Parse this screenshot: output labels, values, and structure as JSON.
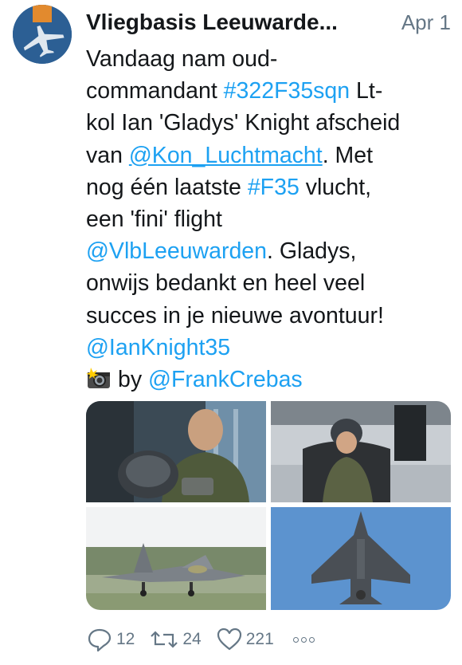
{
  "tweet": {
    "author_name": "Vliegbasis Leeuwarde...",
    "date": "Apr 1",
    "text_lines": [
      [
        {
          "t": "Vandaag nam oud-"
        }
      ],
      [
        {
          "t": "commandant "
        },
        {
          "t": "#322F35sqn",
          "link": true
        },
        {
          "t": " Lt-"
        }
      ],
      [
        {
          "t": "kol Ian 'Gladys' Knight afscheid"
        }
      ],
      [
        {
          "t": "van "
        },
        {
          "t": "@Kon_Luchtmacht",
          "link": true,
          "underline": true
        },
        {
          "t": ". Met"
        }
      ],
      [
        {
          "t": "nog één laatste "
        },
        {
          "t": "#F35",
          "link": true
        },
        {
          "t": " vlucht,"
        }
      ],
      [
        {
          "t": "een 'fini' flight"
        }
      ],
      [
        {
          "t": "@VlbLeeuwarden",
          "link": true
        },
        {
          "t": ". Gladys,"
        }
      ],
      [
        {
          "t": "onwijs bedankt en heel veel"
        }
      ],
      [
        {
          "t": "succes in je nieuwe avontuur!"
        }
      ],
      [
        {
          "t": "@IanKnight35",
          "link": true
        }
      ]
    ],
    "credit_by": "by",
    "credit_handle": "@FrankCrebas",
    "camera_icon": "camera-flash-icon"
  },
  "media": {
    "photos": [
      {
        "subject": "pilot-with-helmet"
      },
      {
        "subject": "pilot-in-cockpit"
      },
      {
        "subject": "f35-on-runway"
      },
      {
        "subject": "f35-underside-in-sky"
      }
    ]
  },
  "actions": {
    "reply_count": "12",
    "retweet_count": "24",
    "like_count": "221"
  },
  "colors": {
    "link": "#1da1f2",
    "muted": "#657786",
    "text": "#14171a",
    "avatar_bg": "#2c5f94",
    "avatar_accent": "#e28a2e"
  }
}
